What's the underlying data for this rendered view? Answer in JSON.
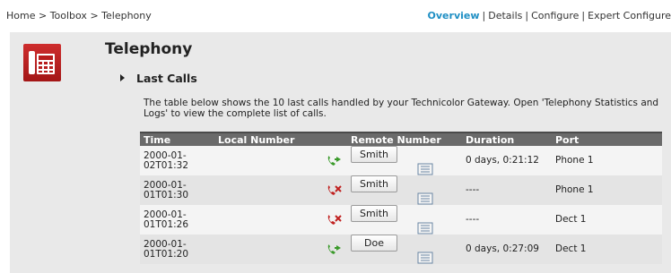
{
  "nav": {
    "breadcrumb": "Home > Toolbox > Telephony",
    "links": [
      {
        "label": "Overview",
        "active": true
      },
      {
        "label": "Details",
        "active": false
      },
      {
        "label": "Configure",
        "active": false
      },
      {
        "label": "Expert Configure",
        "active": false
      }
    ],
    "separator": "|"
  },
  "page": {
    "title": "Telephony",
    "icon": "telephone-icon",
    "section_title": "Last Calls",
    "description": "The table below shows the 10 last calls handled by your Technicolor Gateway. Open 'Telephony Statistics and Logs' to view the complete list of calls."
  },
  "table": {
    "headers": {
      "time": "Time",
      "local": "Local Number",
      "remote": "Remote Number",
      "duration": "Duration",
      "port": "Port"
    },
    "rows": [
      {
        "time_line1": "2000-01-",
        "time_line2": "02T01:32",
        "local": "",
        "direction_icon": "incoming-call-green-icon",
        "remote": "Smith",
        "duration": "0 days, 0:21:12",
        "port": "Phone 1"
      },
      {
        "time_line1": "2000-01-",
        "time_line2": "01T01:30",
        "local": "",
        "direction_icon": "missed-call-red-icon",
        "remote": "Smith",
        "duration": "----",
        "port": "Phone 1"
      },
      {
        "time_line1": "2000-01-",
        "time_line2": "01T01:26",
        "local": "",
        "direction_icon": "missed-call-red-icon",
        "remote": "Smith",
        "duration": "----",
        "port": "Dect 1"
      },
      {
        "time_line1": "2000-01-",
        "time_line2": "01T01:20",
        "local": "",
        "direction_icon": "incoming-call-green-icon",
        "remote": "Doe",
        "duration": "0 days, 0:27:09",
        "port": "Dect 1"
      }
    ]
  },
  "colors": {
    "accent_link": "#1f8fc4",
    "icon_red": "#c0201f",
    "icon_green": "#3a9a2a",
    "header_bg": "#6a6a6a"
  }
}
